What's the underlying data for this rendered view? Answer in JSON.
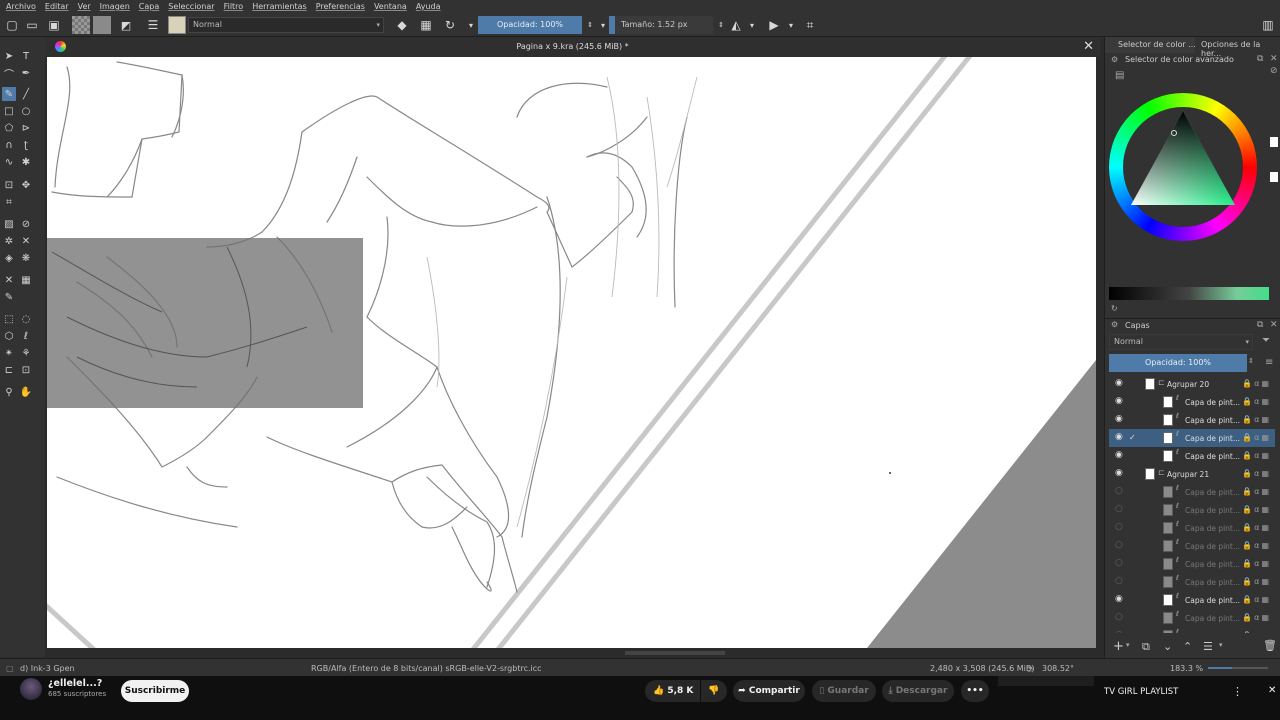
{
  "menu": [
    "Archivo",
    "Editar",
    "Ver",
    "Imagen",
    "Capa",
    "Seleccionar",
    "Filtro",
    "Herramientas",
    "Preferencias",
    "Ventana",
    "Ayuda"
  ],
  "toolbar": {
    "blend_mode": "Normal",
    "opacity_label": "Opacidad: 100%",
    "size_label": "Tamaño: 1.52 px"
  },
  "document": {
    "title": "Pagina x 9.kra (245.6 MiB) *",
    "close_glyph": "✕"
  },
  "status": {
    "brush": "d) Ink-3 Gpen",
    "color_space": "RGB/Alfa (Entero de 8 bits/canal)  sRGB-elle-V2-srgbtrc.icc",
    "dimensions": "2,480 x 3,508 (245.6 MiB)",
    "rotation": "308.52°",
    "zoom": "183.3 %"
  },
  "docker": {
    "tab_color": "Selector de color ...",
    "tab_tool": "Opciones de la her...",
    "color_title": "Selector de color avanzado",
    "layers_title": "Capas",
    "layers_blend": "Normal",
    "layers_opacity": "Opacidad:  100%",
    "layers": [
      {
        "name": "Agrupar 20",
        "type": "group",
        "visible": true,
        "dim": false,
        "selected": false,
        "indent": 0
      },
      {
        "name": "Capa de pint...",
        "type": "paint",
        "visible": true,
        "dim": false,
        "selected": false,
        "indent": 1
      },
      {
        "name": "Capa de pint...",
        "type": "paint",
        "visible": true,
        "dim": false,
        "selected": false,
        "indent": 1
      },
      {
        "name": "Capa de pint...",
        "type": "paint",
        "visible": true,
        "dim": false,
        "selected": true,
        "indent": 1
      },
      {
        "name": "Capa de pint...",
        "type": "paint",
        "visible": true,
        "dim": false,
        "selected": false,
        "indent": 1
      },
      {
        "name": "Agrupar 21",
        "type": "group",
        "visible": true,
        "dim": false,
        "selected": false,
        "indent": 0
      },
      {
        "name": "Capa de pint...",
        "type": "paint",
        "visible": false,
        "dim": true,
        "selected": false,
        "indent": 1
      },
      {
        "name": "Capa de pint...",
        "type": "paint",
        "visible": false,
        "dim": true,
        "selected": false,
        "indent": 1
      },
      {
        "name": "Capa de pint...",
        "type": "paint",
        "visible": false,
        "dim": true,
        "selected": false,
        "indent": 1
      },
      {
        "name": "Capa de pint...",
        "type": "paint",
        "visible": false,
        "dim": true,
        "selected": false,
        "indent": 1
      },
      {
        "name": "Capa de pint...",
        "type": "paint",
        "visible": false,
        "dim": true,
        "selected": false,
        "indent": 1
      },
      {
        "name": "Capa de pint...",
        "type": "paint",
        "visible": false,
        "dim": true,
        "selected": false,
        "indent": 1
      },
      {
        "name": "Capa de pint...",
        "type": "paint",
        "visible": true,
        "dim": false,
        "selected": false,
        "indent": 1
      },
      {
        "name": "Capa de pint...",
        "type": "paint",
        "visible": false,
        "dim": true,
        "selected": false,
        "indent": 1
      },
      {
        "name": "Capa de pint...",
        "type": "paint",
        "visible": false,
        "dim": true,
        "selected": false,
        "indent": 1
      }
    ]
  },
  "youtube": {
    "channel": "¿ellelel...?",
    "subscribers": "685 suscriptores",
    "subscribe": "Suscribirme",
    "likes": "5,8 K",
    "share": "Compartir",
    "save": "Guardar",
    "download": "Descargar",
    "playlist": "TV GIRL PLAYLIST"
  },
  "colors": {
    "accent": "#4f7ba8",
    "panel": "#323232",
    "canvas": "#ffffff",
    "selection_gray": "#8c8c8c"
  }
}
